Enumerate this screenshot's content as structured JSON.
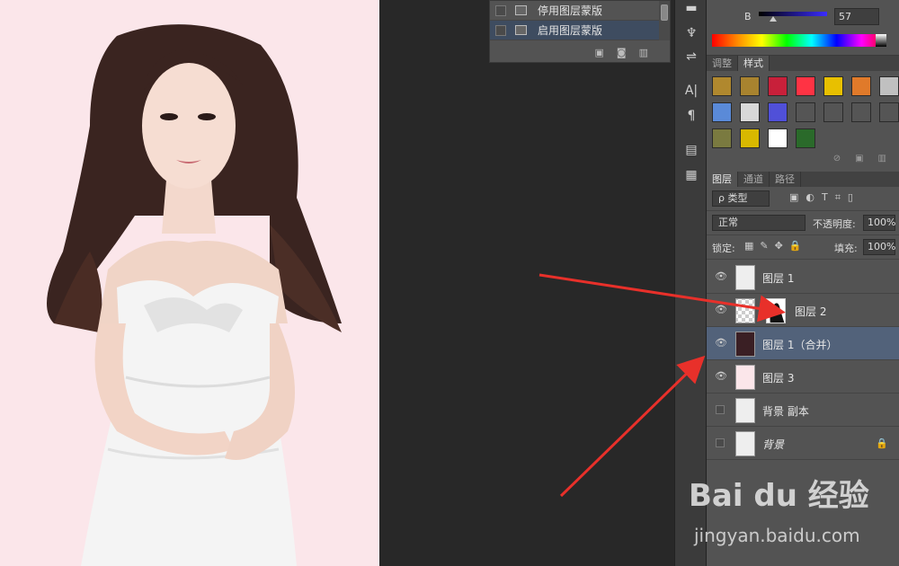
{
  "actions_panel": {
    "items": [
      {
        "label": "停用图层蒙版",
        "selected": false
      },
      {
        "label": "启用图层蒙版",
        "selected": true
      }
    ]
  },
  "tool_strip": {
    "icons": [
      "brush-settings-icon",
      "clone-source-icon",
      "character-icon",
      "paragraph-icon",
      "notes-icon",
      "info-icon"
    ]
  },
  "color_panel": {
    "channel_label": "B",
    "channel_value": "57"
  },
  "styles_panel": {
    "tabs": [
      {
        "label": "调整",
        "active": false
      },
      {
        "label": "样式",
        "active": true
      }
    ],
    "swatches": [
      "#b0882e",
      "#a8832f",
      "#c8203a",
      "#ff3344",
      "#e8c000",
      "#e07a2a",
      "#c0c0c0",
      "#5a8ad8",
      "#d8d8d8",
      "#5050d8",
      "#555555",
      "#555555",
      "#555555",
      "#555555",
      "#7a7a40",
      "#d8b800",
      "#ffffff",
      "#2a6a2a"
    ]
  },
  "layers_panel": {
    "tabs": [
      {
        "label": "图层",
        "active": true
      },
      {
        "label": "通道",
        "active": false
      },
      {
        "label": "路径",
        "active": false
      }
    ],
    "filter_label": "ρ 类型",
    "blend_mode": "正常",
    "opacity_label": "不透明度:",
    "opacity_value": "100%",
    "lock_label": "锁定:",
    "fill_label": "填充:",
    "fill_value": "100%",
    "layers": [
      {
        "name": "图层 1",
        "visible": true,
        "thumb": "photo",
        "selected": false,
        "mask": false,
        "italic": false,
        "locked": false
      },
      {
        "name": "图层 2",
        "visible": true,
        "thumb": "check",
        "selected": false,
        "mask": true,
        "italic": false,
        "locked": false
      },
      {
        "name": "图层 1（合并）",
        "visible": true,
        "thumb": "dark",
        "selected": true,
        "mask": false,
        "italic": false,
        "locked": false
      },
      {
        "name": "图层 3",
        "visible": true,
        "thumb": "pink",
        "selected": false,
        "mask": false,
        "italic": false,
        "locked": false
      },
      {
        "name": "背景 副本",
        "visible": false,
        "thumb": "photo",
        "selected": false,
        "mask": false,
        "italic": false,
        "locked": false
      },
      {
        "name": "背景",
        "visible": false,
        "thumb": "photo",
        "selected": false,
        "mask": false,
        "italic": true,
        "locked": true
      }
    ]
  },
  "watermark": {
    "logo": "Bai du 经验",
    "url": "jingyan.baidu.com"
  },
  "accent_colors": {
    "arrow": "#e8302a",
    "selection": "#52627a"
  }
}
